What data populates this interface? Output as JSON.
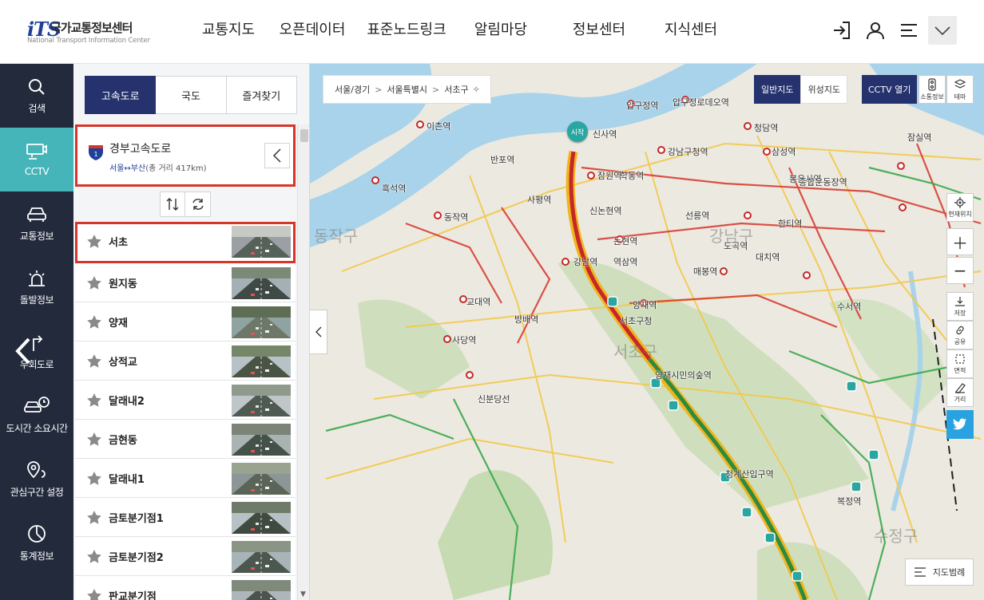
{
  "header": {
    "logo_mark": "iTS",
    "logo_title": "국가교통정보센터",
    "logo_subtitle": "National Transport Information Center",
    "nav": [
      "교통지도",
      "오픈데이터",
      "표준노드링크",
      "알림마당",
      "정보센터",
      "지식센터"
    ],
    "icons": [
      "login-icon",
      "user-icon",
      "menu-icon",
      "chevron-down-icon"
    ]
  },
  "rail": {
    "items": [
      {
        "label": "검색",
        "icon": "search-icon",
        "active": false
      },
      {
        "label": "CCTV",
        "icon": "cctv-icon",
        "active": true
      },
      {
        "label": "교통정보",
        "icon": "car-icon",
        "active": false
      },
      {
        "label": "돌발정보",
        "icon": "alert-icon",
        "active": false
      },
      {
        "label": "우회도로",
        "icon": "detour-icon",
        "active": false
      },
      {
        "label": "도시간 소요시간",
        "icon": "travel-time-icon",
        "active": false
      },
      {
        "label": "관심구간 설정",
        "icon": "location-pin-icon",
        "active": false
      },
      {
        "label": "통계정보",
        "icon": "statistics-icon",
        "active": false
      }
    ]
  },
  "panel": {
    "tabs": [
      {
        "label": "고속도로",
        "active": true
      },
      {
        "label": "국도",
        "active": false
      },
      {
        "label": "즐겨찾기",
        "active": false
      }
    ],
    "route": {
      "number": "1",
      "name": "경부고속도로",
      "from_to": "서울↔부산",
      "distance": "(총 거리 417km)"
    },
    "cctv_items": [
      "서초",
      "원지동",
      "양재",
      "상적교",
      "달래내2",
      "금현동",
      "달래내1",
      "금토분기점1",
      "금토분기점2",
      "판교분기점"
    ],
    "selected_index": 0
  },
  "map": {
    "breadcrumb": [
      "서울/경기",
      "서울특별시",
      "서초구"
    ],
    "map_types": [
      {
        "label": "일반지도",
        "active": true
      },
      {
        "label": "위성지도",
        "active": false
      }
    ],
    "cctv_open": "CCTV 열기",
    "top_tools": [
      "소통정보",
      "테마"
    ],
    "right_tools": [
      "현재위치",
      "저장",
      "공유",
      "면적",
      "거리"
    ],
    "start_label": "시작",
    "legend_label": "지도범례",
    "districts": [
      "동작구",
      "강남구",
      "서초구",
      "수정구"
    ],
    "places": [
      "이촌역",
      "흑석역",
      "동작역",
      "반포역",
      "사평역",
      "잠원역",
      "신사역",
      "압구정역",
      "압구정로데오역",
      "청담역",
      "강남구청역",
      "학동역",
      "논현역",
      "신논현역",
      "선릉역",
      "삼성역",
      "교대역",
      "강남역",
      "역삼역",
      "양재역",
      "방배역",
      "사당역",
      "서초구청",
      "대치역",
      "수서역",
      "매봉역",
      "도곡역",
      "양재시민의숲역",
      "청계산입구역",
      "신분당선",
      "잠실역",
      "봉은사역",
      "종합운동장역",
      "한티역",
      "복정역"
    ],
    "colors": {
      "congested": "#d7352a",
      "slow": "#f0b51e",
      "smooth": "#3aa84b",
      "water": "#a9d3ea",
      "park": "#c9dcb6"
    }
  }
}
